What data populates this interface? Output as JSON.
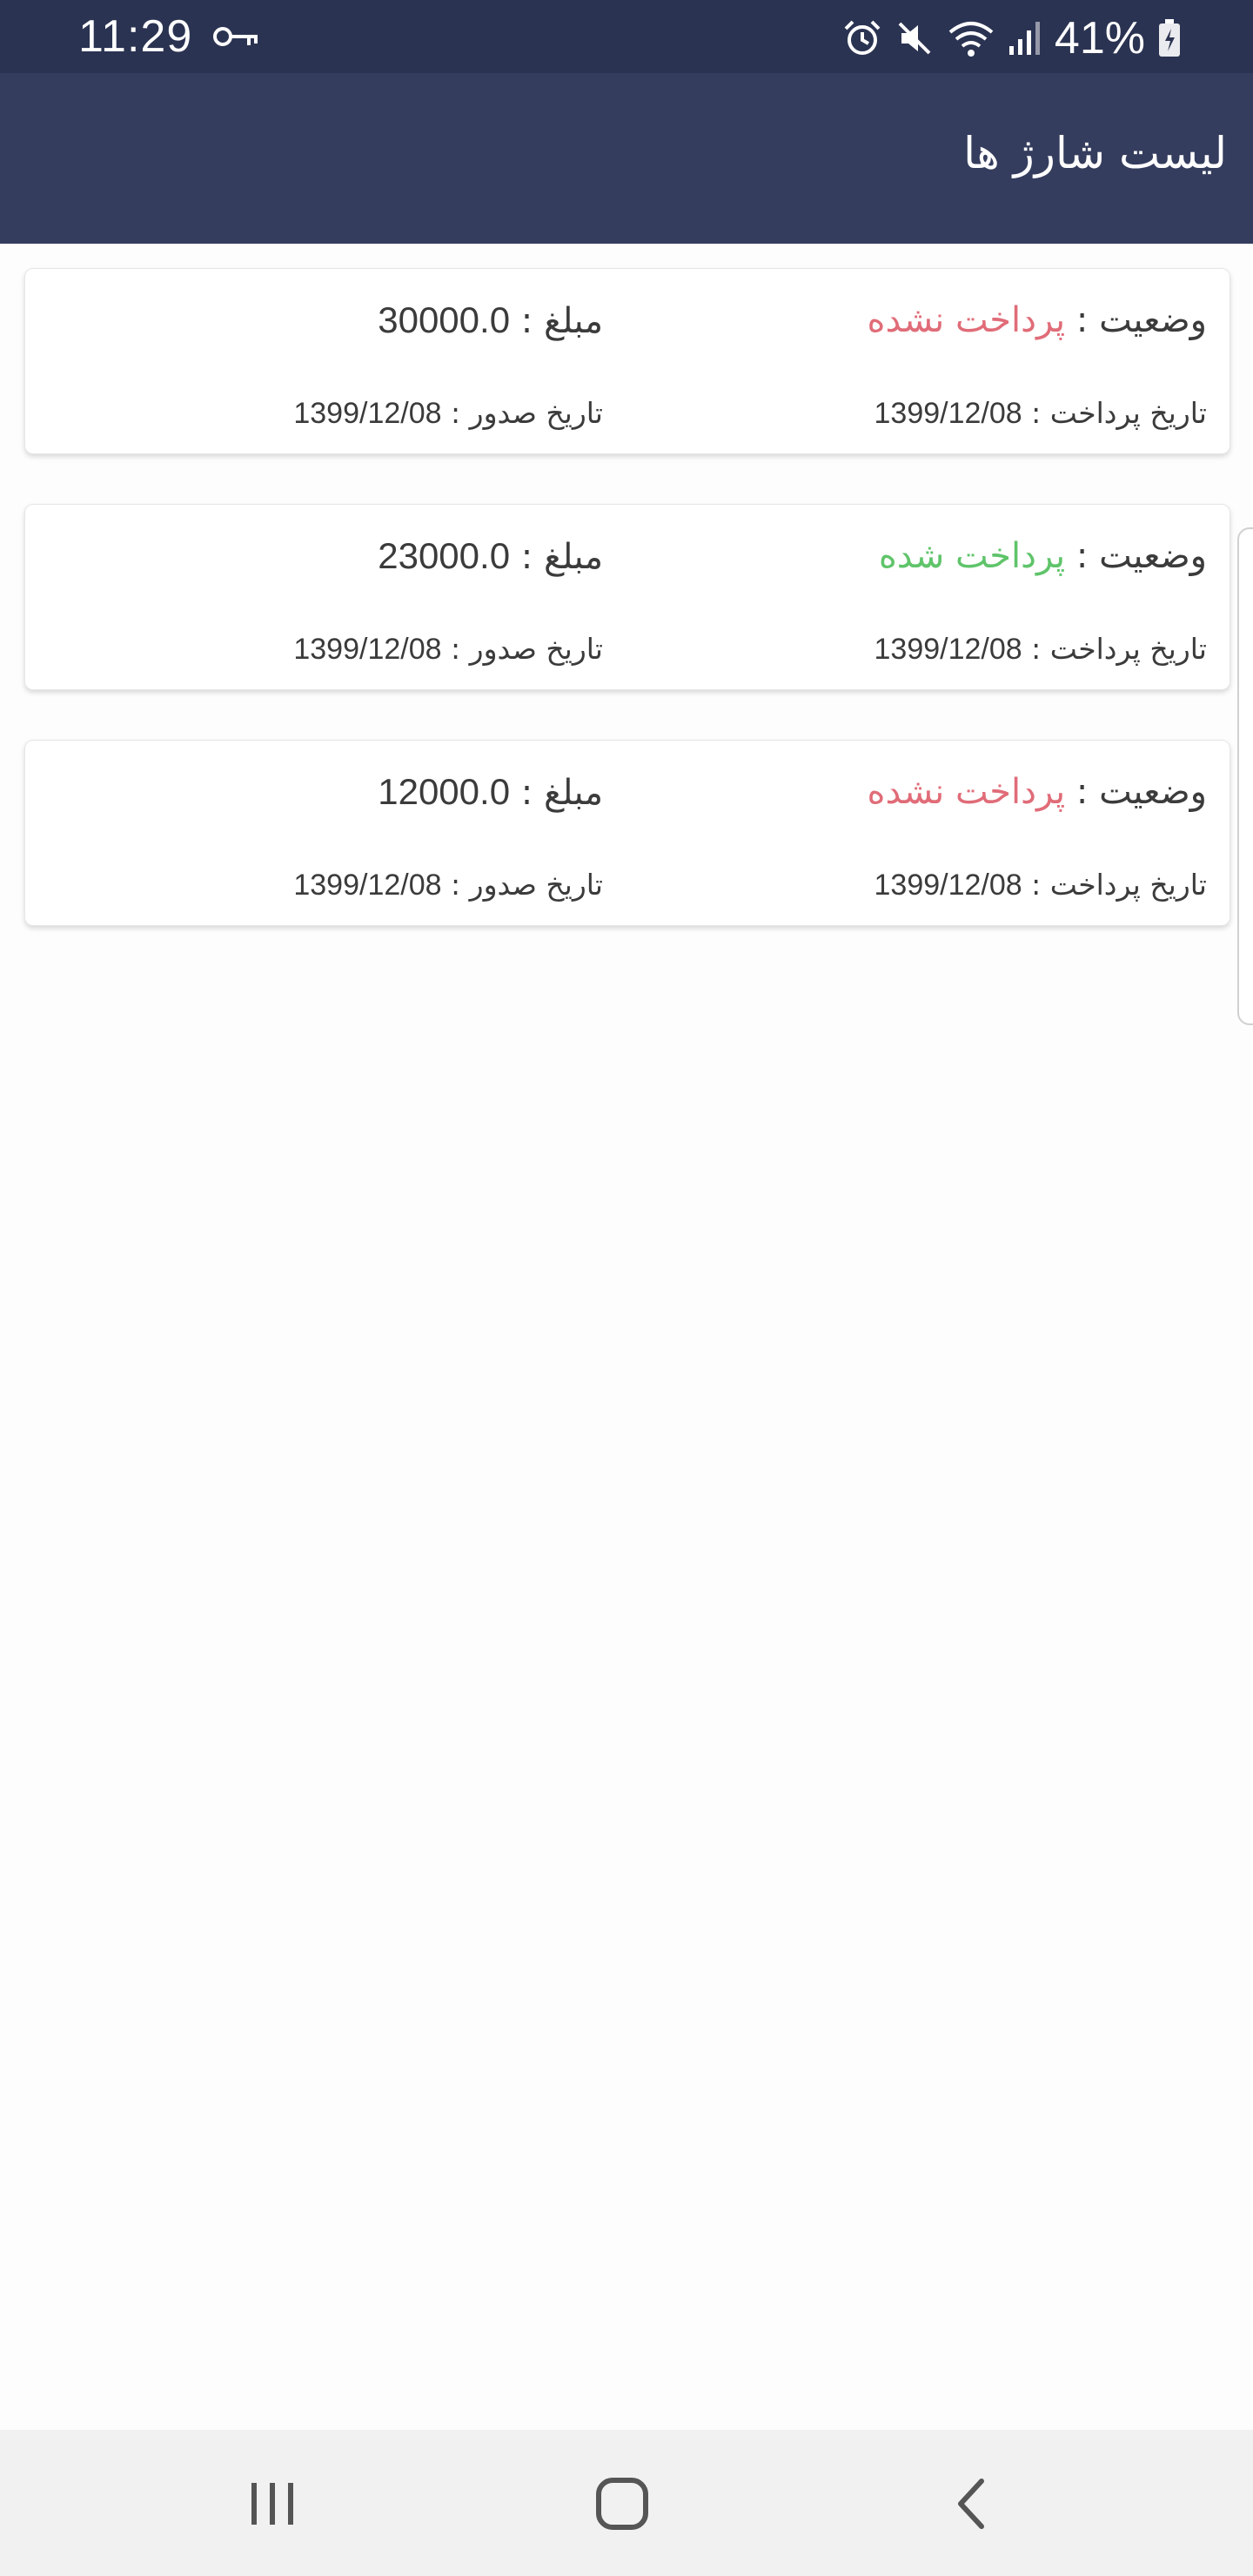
{
  "status_bar": {
    "time": "11:29",
    "battery": "41%",
    "icons": [
      "key-icon",
      "alarm-icon",
      "mute-icon",
      "wifi-icon",
      "signal-icon",
      "battery-icon"
    ]
  },
  "header": {
    "title": "لیست شارژ ها"
  },
  "labels": {
    "status": "وضعیت : ",
    "amount": "مبلغ : ",
    "pay_date": "تاریخ پرداخت : ",
    "issue_date": "تاریخ صدور : "
  },
  "charges": [
    {
      "status": "پرداخت نشده",
      "amount": "30000.0",
      "pay_date": "1399/12/08",
      "issue_date": "1399/12/08"
    },
    {
      "status": "پرداخت شده",
      "amount": "23000.0",
      "pay_date": "1399/12/08",
      "issue_date": "1399/12/08"
    },
    {
      "status": "پرداخت نشده",
      "amount": "12000.0",
      "pay_date": "1399/12/08",
      "issue_date": "1399/12/08"
    }
  ],
  "colors": {
    "status_bar": "#2b3352",
    "app_bar": "#353d5e",
    "unpaid": "#e06c78",
    "paid": "#5fc46a",
    "text": "#3b3b3b"
  },
  "nav_bar": {
    "buttons": [
      "recent-apps-icon",
      "home-icon",
      "back-icon"
    ]
  }
}
